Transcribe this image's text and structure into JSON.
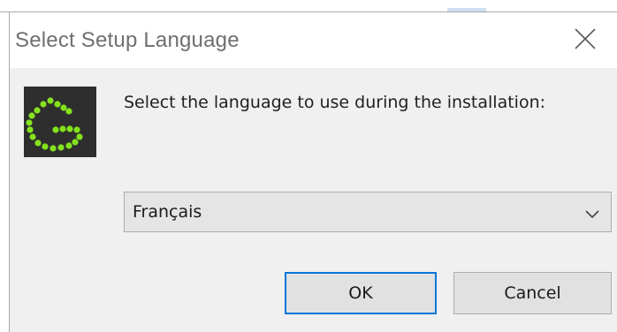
{
  "window": {
    "title": "Select Setup Language"
  },
  "icons": {
    "close": "close-icon",
    "logo": "app-logo",
    "dropdown": "chevron-down-icon"
  },
  "dialog": {
    "message": "Select the language to use during the installation:",
    "language_select": {
      "selected": "Français"
    },
    "buttons": {
      "ok": "OK",
      "cancel": "Cancel"
    }
  },
  "colors": {
    "accent_focus": "#0078d7",
    "logo_green": "#84e21c",
    "logo_bg": "#2e2e2e",
    "dialog_bg": "#f0f0f0"
  }
}
